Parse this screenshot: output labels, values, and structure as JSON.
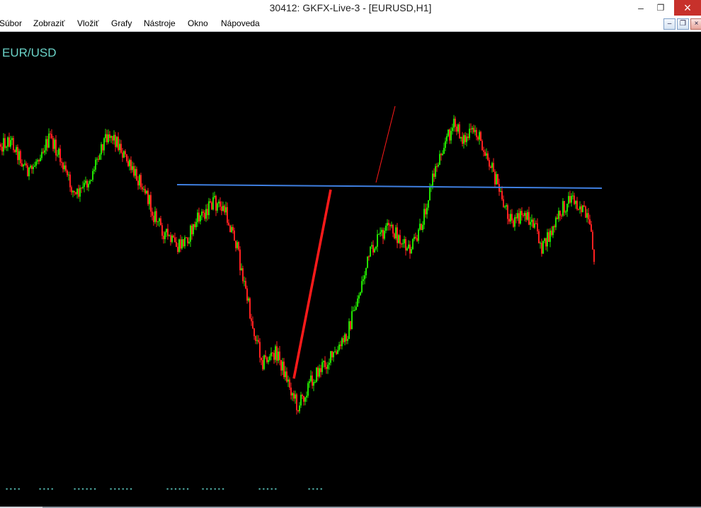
{
  "window": {
    "title": "30412: GKFX-Live-3 - [EURUSD,H1]",
    "minimize_glyph": "–",
    "restore_glyph": "❐",
    "close_glyph": "×"
  },
  "menu": {
    "items": [
      {
        "label": "Súbor"
      },
      {
        "label": "Zobraziť"
      },
      {
        "label": "Vložiť"
      },
      {
        "label": "Grafy"
      },
      {
        "label": "Nástroje"
      },
      {
        "label": "Okno"
      },
      {
        "label": "Nápoveda"
      }
    ]
  },
  "mdi_controls": {
    "minimize_glyph": "–",
    "restore_glyph": "❐",
    "close_glyph": "×"
  },
  "chart": {
    "symbol": "EUR/USD",
    "background": "#000000",
    "bull_color": "#22e000",
    "bear_color": "#ff2020",
    "hline_color": "#3f7fe0",
    "trendline_color": "#ff1a1a"
  },
  "chart_data": {
    "type": "candlestick",
    "symbol": "EURUSD",
    "timeframe": "H1",
    "price_path": [
      [
        0,
        0.2
      ],
      [
        15,
        0.18
      ],
      [
        30,
        0.28
      ],
      [
        42,
        0.34
      ],
      [
        55,
        0.24
      ],
      [
        70,
        0.17
      ],
      [
        85,
        0.28
      ],
      [
        105,
        0.45
      ],
      [
        115,
        0.42
      ],
      [
        128,
        0.35
      ],
      [
        140,
        0.22
      ],
      [
        152,
        0.14
      ],
      [
        165,
        0.19
      ],
      [
        185,
        0.33
      ],
      [
        200,
        0.38
      ],
      [
        215,
        0.53
      ],
      [
        232,
        0.63
      ],
      [
        250,
        0.7
      ],
      [
        265,
        0.64
      ],
      [
        280,
        0.55
      ],
      [
        300,
        0.48
      ],
      [
        315,
        0.51
      ],
      [
        330,
        0.64
      ],
      [
        340,
        0.8
      ],
      [
        355,
        1.06
      ],
      [
        370,
        1.24
      ],
      [
        390,
        1.2
      ],
      [
        405,
        1.33
      ],
      [
        420,
        1.46
      ],
      [
        435,
        1.35
      ],
      [
        455,
        1.26
      ],
      [
        475,
        1.2
      ],
      [
        490,
        1.1
      ],
      [
        505,
        0.93
      ],
      [
        520,
        0.74
      ],
      [
        535,
        0.64
      ],
      [
        550,
        0.6
      ],
      [
        565,
        0.66
      ],
      [
        575,
        0.72
      ],
      [
        590,
        0.64
      ],
      [
        600,
        0.5
      ],
      [
        612,
        0.34
      ],
      [
        625,
        0.2
      ],
      [
        640,
        0.11
      ],
      [
        655,
        0.18
      ],
      [
        670,
        0.13
      ],
      [
        685,
        0.23
      ],
      [
        700,
        0.38
      ],
      [
        712,
        0.5
      ],
      [
        725,
        0.58
      ],
      [
        740,
        0.53
      ],
      [
        755,
        0.6
      ],
      [
        765,
        0.7
      ],
      [
        778,
        0.62
      ],
      [
        790,
        0.53
      ],
      [
        805,
        0.45
      ],
      [
        820,
        0.5
      ],
      [
        830,
        0.58
      ],
      [
        838,
        0.73
      ]
    ]
  }
}
